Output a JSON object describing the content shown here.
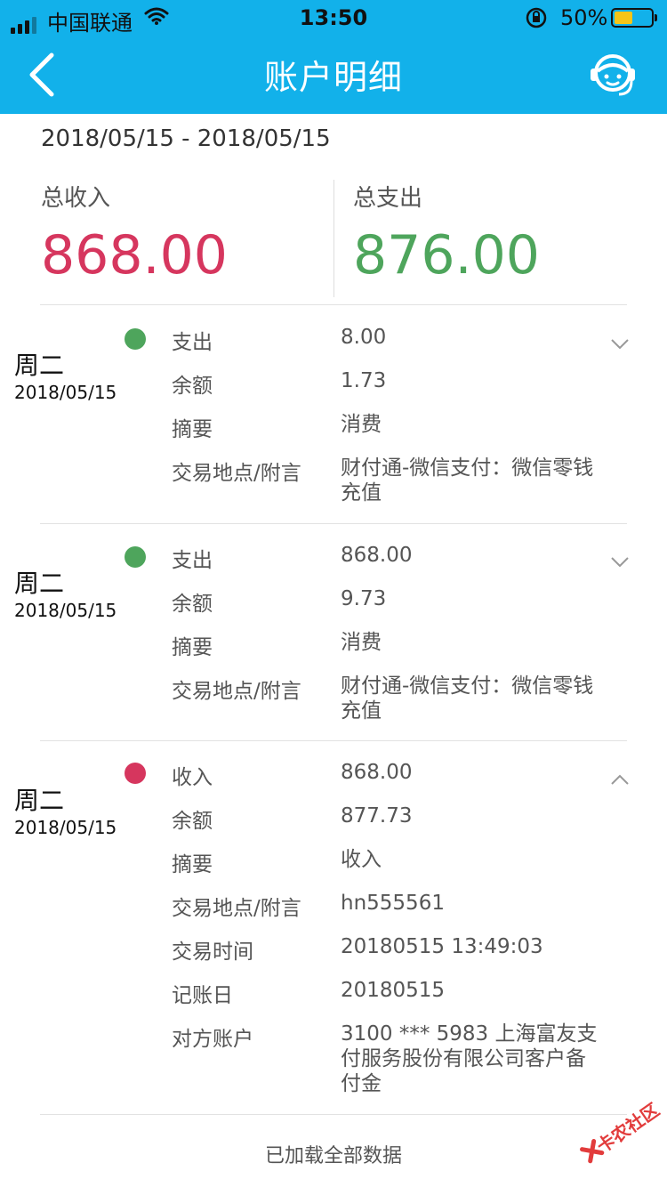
{
  "status_bar": {
    "carrier": "中国联通",
    "time": "13:50",
    "battery_percent": "50%",
    "battery_level": 0.5
  },
  "nav": {
    "title": "账户明细",
    "back_icon": "chevron-left-icon",
    "service_icon": "customer-service-icon"
  },
  "summary": {
    "date_range": "2018/05/15 - 2018/05/15",
    "income_label": "总收入",
    "income_value": "868.00",
    "expense_label": "总支出",
    "expense_value": "876.00"
  },
  "colors": {
    "header": "#12b1ea",
    "income": "#d6365e",
    "expense": "#4ea55c"
  },
  "entries": [
    {
      "weekday": "周二",
      "date": "2018/05/15",
      "type": "expense",
      "expanded": false,
      "rows": [
        {
          "label": "支出",
          "value": "8.00"
        },
        {
          "label": "余额",
          "value": "1.73"
        },
        {
          "label": "摘要",
          "value": "消费"
        },
        {
          "label": "交易地点/附言",
          "value": "财付通-微信支付：微信零钱充值"
        }
      ]
    },
    {
      "weekday": "周二",
      "date": "2018/05/15",
      "type": "expense",
      "expanded": false,
      "rows": [
        {
          "label": "支出",
          "value": "868.00"
        },
        {
          "label": "余额",
          "value": "9.73"
        },
        {
          "label": "摘要",
          "value": "消费"
        },
        {
          "label": "交易地点/附言",
          "value": "财付通-微信支付：微信零钱充值"
        }
      ]
    },
    {
      "weekday": "周二",
      "date": "2018/05/15",
      "type": "income",
      "expanded": true,
      "rows": [
        {
          "label": "收入",
          "value": "868.00"
        },
        {
          "label": "余额",
          "value": "877.73"
        },
        {
          "label": "摘要",
          "value": "收入"
        },
        {
          "label": "交易地点/附言",
          "value": "hn555561"
        },
        {
          "label": "交易时间",
          "value": "20180515 13:49:03"
        },
        {
          "label": "记账日",
          "value": "20180515"
        },
        {
          "label": "对方账户",
          "value": "3100 *** 5983 上海富友支付服务股份有限公司客户备付金"
        }
      ]
    }
  ],
  "footer": {
    "text": "已加载全部数据"
  },
  "watermark": {
    "text": "卡农社区"
  }
}
